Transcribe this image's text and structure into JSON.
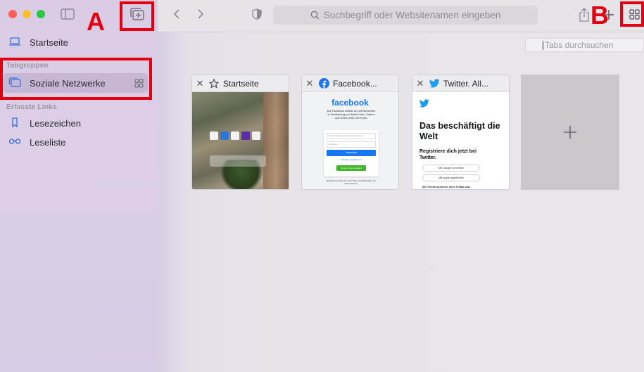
{
  "sidebar": {
    "home_label": "Startseite",
    "tab_groups_header": "Tabgruppen",
    "tab_group_name": "Soziale Netzwerke",
    "captured_links_header": "Erfasste Links",
    "bookmarks_label": "Lesezeichen",
    "reading_list_label": "Leseliste"
  },
  "toolbar": {
    "address_placeholder": "Suchbegriff oder Websitenamen eingeben"
  },
  "tab_search": {
    "placeholder": "Tabs durchsuchen"
  },
  "tabs": [
    {
      "title": "Startseite",
      "favicon": "star-icon"
    },
    {
      "title": "Facebook...",
      "favicon": "facebook-icon",
      "page": {
        "logo": "facebook",
        "text": "Auf Facebook bleibst du mit Menschen in Verbindung und teilst Fotos, Videos und vieles mehr mit ihnen.",
        "email_placeholder": "E-Mail-Adresse oder Telefonnummer",
        "password_placeholder": "Passwort",
        "login": "Anmelden",
        "forgot": "Passwort vergessen?",
        "create": "Neues Konto erstellen",
        "footer": "Erstelle eine Seite für einen Star, eine Band oder ein Unternehmen."
      }
    },
    {
      "title": "Twitter. All...",
      "favicon": "twitter-icon",
      "page": {
        "headline": "Das beschäftigt die Welt",
        "subhead": "Registriere dich jetzt bei Twitter.",
        "google": "Mit Google anmelden",
        "apple": "Mit Apple registrieren",
        "phone": "Mit Telefonnummer oder E-Mail-Adr..."
      }
    }
  ],
  "annotations": {
    "marker_a": "A",
    "marker_b": "B"
  },
  "colors": {
    "highlight": "#e5000f",
    "accent": "#1a73e8",
    "facebook": "#1877f2",
    "twitter": "#1d9bf0"
  }
}
